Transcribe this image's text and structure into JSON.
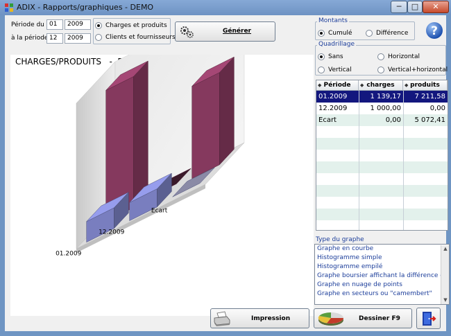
{
  "window": {
    "title": "ADIX - Rapports/graphiques - DEMO",
    "min_glyph": "─",
    "max_glyph": "□",
    "close_glyph": "✕"
  },
  "period": {
    "from_label": "Période du",
    "from_month": "01",
    "from_year": "2009",
    "to_label": "à la période",
    "to_month": "12",
    "to_year": "2009"
  },
  "report_type": {
    "options": [
      {
        "label": "Charges et produits",
        "selected": true
      },
      {
        "label": "Clients et fournisseurs",
        "selected": false
      }
    ]
  },
  "generate_button": {
    "label": "Générer"
  },
  "montants": {
    "title": "Montants",
    "options": [
      {
        "label": "Cumulé",
        "selected": true
      },
      {
        "label": "Différence",
        "selected": false
      }
    ]
  },
  "quadrillage": {
    "title": "Quadrillage",
    "options": [
      {
        "label": "Sans",
        "selected": true
      },
      {
        "label": "Horizontal",
        "selected": false
      },
      {
        "label": "Vertical",
        "selected": false
      },
      {
        "label": "Vertical+horizontal",
        "selected": false
      }
    ]
  },
  "table": {
    "headers": [
      "Période",
      "charges",
      "produits"
    ],
    "rows": [
      {
        "periode": "01.2009",
        "charges": "1 139,17",
        "produits": "7 211,58"
      },
      {
        "periode": "12.2009",
        "charges": "1 000,00",
        "produits": "0,00"
      },
      {
        "periode": "Ecart",
        "charges": "0,00",
        "produits": "5 072,41"
      }
    ]
  },
  "graph_types": {
    "title": "Type du graphe",
    "items": [
      "Graphe en courbe",
      "Histogramme simple",
      "Histogramme empilé",
      "Graphe boursier affichant la différence en",
      "Graphe en nuage de points",
      "Graphe en secteurs ou \"camembert\""
    ]
  },
  "buttons": {
    "print": "Impression",
    "draw": "Dessiner F9"
  },
  "chart_data": {
    "type": "bar",
    "title": "CHARGES/PRODUITS   -  DEMO",
    "categories": [
      "01.2009",
      "12.2009",
      "Ecart"
    ],
    "series": [
      {
        "values": [
          1139.17,
          1000.0,
          0.0
        ]
      },
      {
        "values": [
          7211.58,
          0.0,
          5072.41
        ]
      }
    ],
    "colors": {
      "charges": "#7f85c9",
      "produits": "#8c3c63"
    },
    "three_d": true,
    "grid": false
  }
}
